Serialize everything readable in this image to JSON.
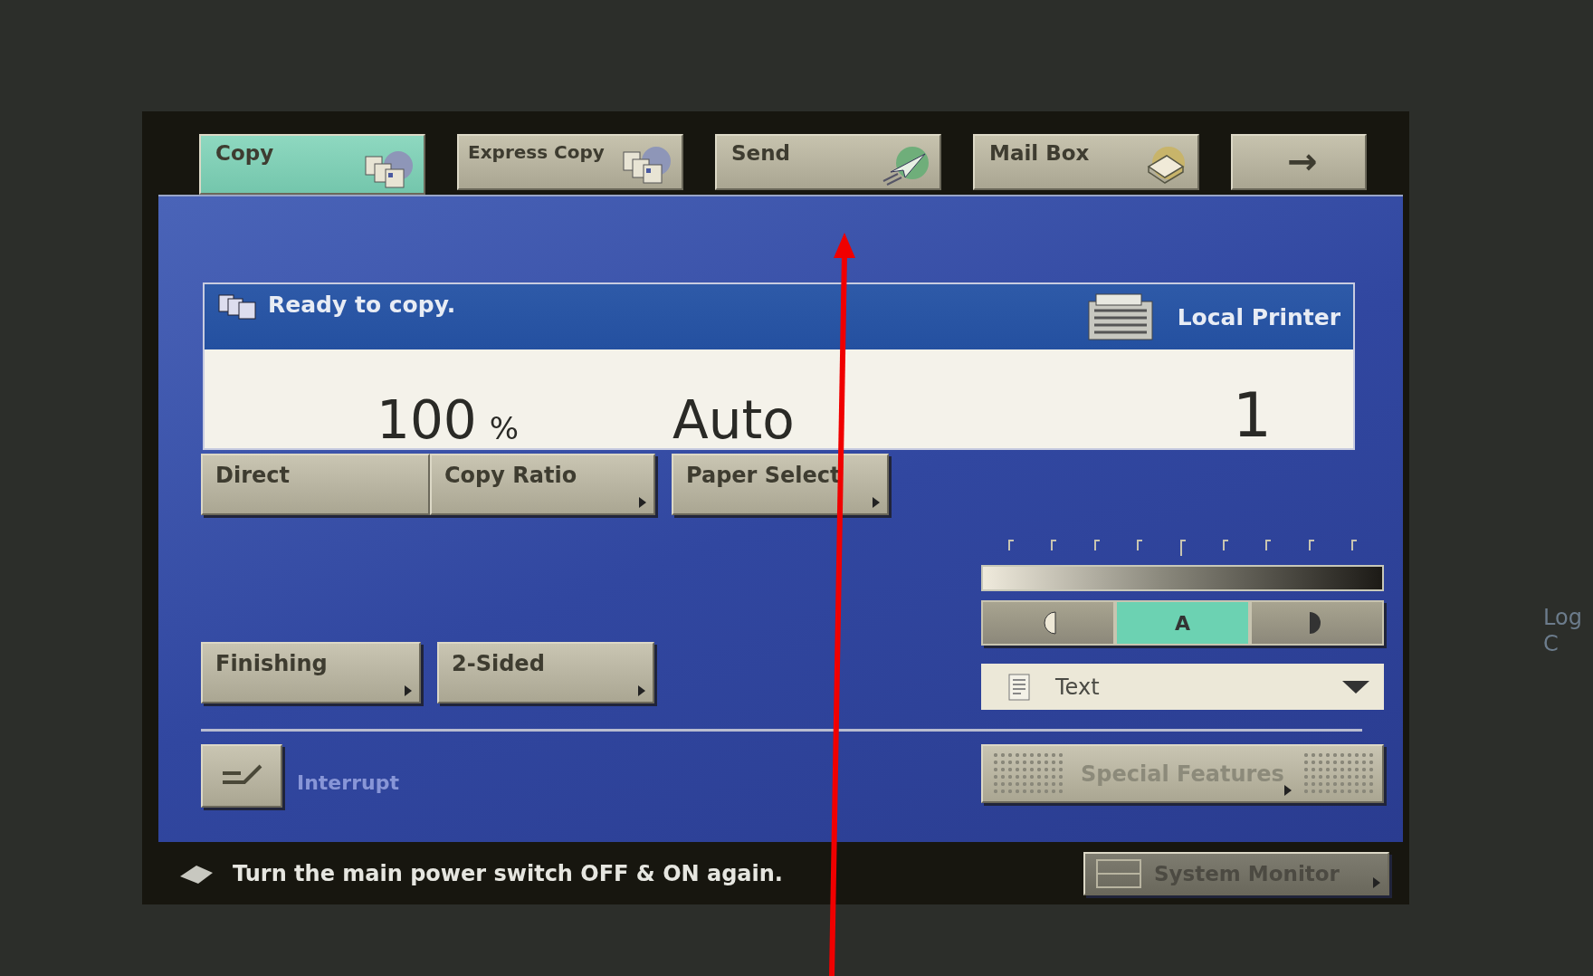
{
  "tabs": [
    {
      "label": "Copy",
      "selected": true
    },
    {
      "label": "Express Copy",
      "selected": false
    },
    {
      "label": "Send",
      "selected": false
    },
    {
      "label": "Mail Box",
      "selected": false
    },
    {
      "label": "→",
      "selected": false
    }
  ],
  "status": {
    "message": "Ready to copy.",
    "printer": "Local Printer"
  },
  "readout": {
    "ratio": "100",
    "ratio_unit": "%",
    "paper": "Auto",
    "copies": "1"
  },
  "top_buttons": [
    {
      "label": "Direct",
      "kind": "plain"
    },
    {
      "label": "Copy Ratio",
      "kind": "submenu"
    },
    {
      "label": "Paper Select",
      "kind": "submenu"
    }
  ],
  "density": {
    "modes": [
      {
        "kind": "lighter",
        "selected": false
      },
      {
        "kind": "text",
        "label": "A",
        "selected": true
      },
      {
        "kind": "darker",
        "selected": false
      }
    ],
    "image_type": "Text"
  },
  "mid_buttons": [
    {
      "label": "Finishing",
      "kind": "submenu"
    },
    {
      "label": "2-Sided",
      "kind": "submenu"
    }
  ],
  "interrupt": {
    "label": "Interrupt",
    "disabled": true
  },
  "special_features": {
    "label": "Special Features",
    "disabled": true
  },
  "message_bar": {
    "text": "Turn the main power switch OFF & ON again.",
    "system_monitor": {
      "label": "System Monitor",
      "disabled": true
    }
  },
  "bezel_labels": [
    "Log",
    "C"
  ]
}
